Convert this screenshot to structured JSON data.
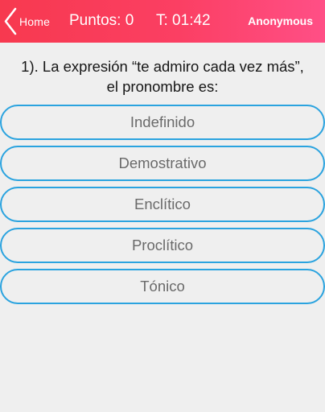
{
  "header": {
    "home_label": "Home",
    "score_text": "Puntos: 0",
    "timer_text": "T: 01:42",
    "user_name": "Anonymous",
    "icons": {
      "back": "chevron-left-icon"
    },
    "colors": {
      "gradient_start": "#f7394f",
      "gradient_end": "#ff4f86",
      "text": "#ffffff"
    }
  },
  "question": {
    "line1": "1). La expresión “te admiro cada vez más”,",
    "line2": "el pronombre es:"
  },
  "options": [
    {
      "label": "Indefinido"
    },
    {
      "label": "Demostrativo"
    },
    {
      "label": "Enclítico"
    },
    {
      "label": "Proclítico"
    },
    {
      "label": "Tónico"
    }
  ],
  "colors": {
    "option_border": "#2aa3df",
    "option_text": "#6a6a6a",
    "background": "#efefef"
  }
}
